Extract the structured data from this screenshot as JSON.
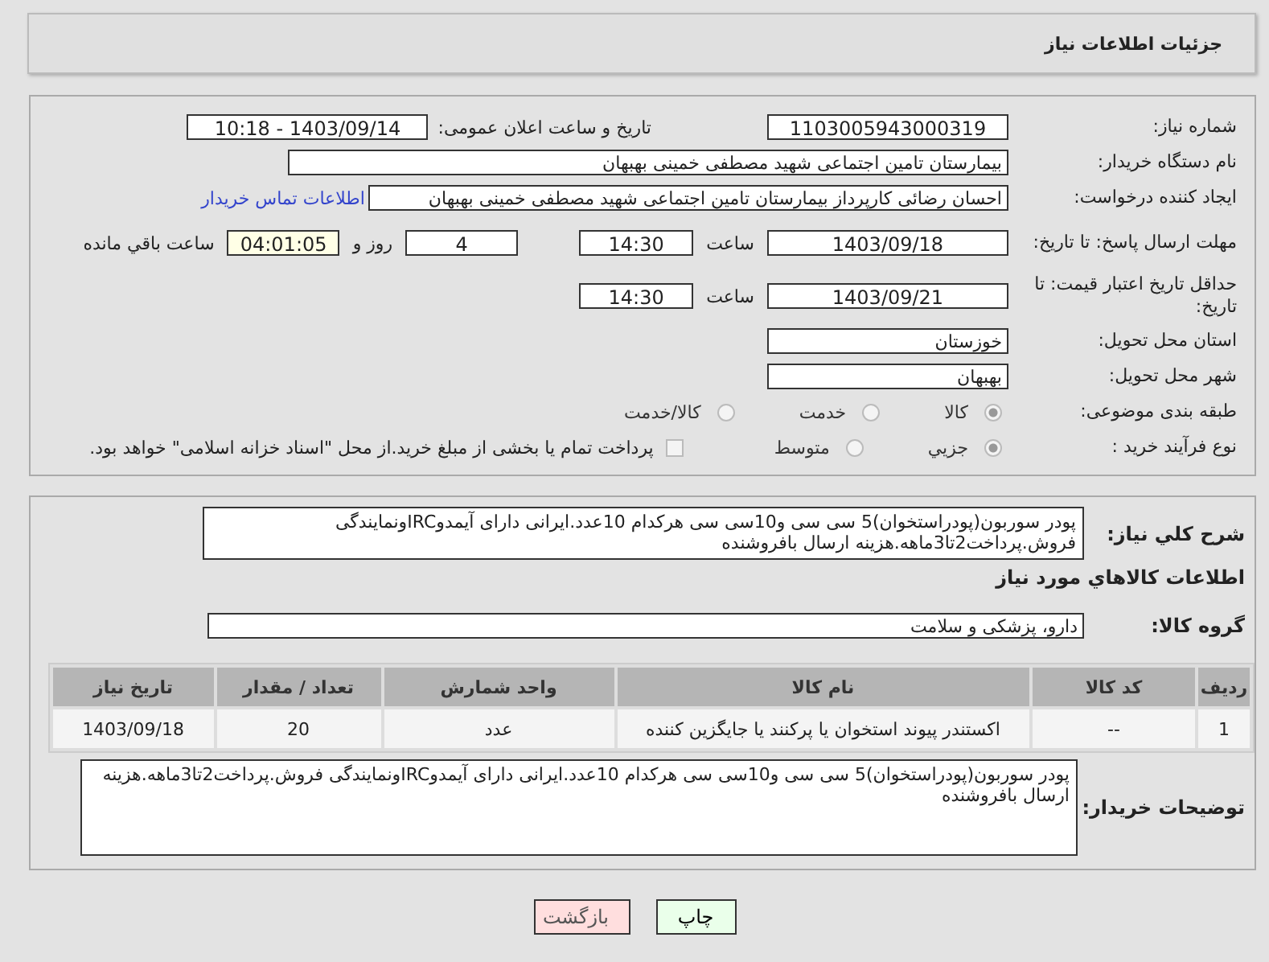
{
  "header": {
    "title": "جزئیات اطلاعات نیاز"
  },
  "details": {
    "need_number": {
      "label": "شماره نیاز:",
      "value": "1103005943000319"
    },
    "announce": {
      "label": "تاریخ و ساعت اعلان عمومی:",
      "value": "1403/09/14 - 10:18"
    },
    "buyer": {
      "label": "نام دستگاه خریدار:",
      "value": "بیمارستان تامین اجتماعی شهید مصطفی خمینی بهبهان"
    },
    "creator": {
      "label": "ایجاد کننده درخواست:",
      "value": "احسان رضائی کارپرداز بیمارستان تامین اجتماعی شهید مصطفی خمینی بهبهان",
      "link": "اطلاعات تماس خریدار"
    },
    "deadline": {
      "label": "مهلت ارسال پاسخ: تا تاریخ:",
      "date": "1403/09/18",
      "time_label": "ساعت",
      "time": "14:30",
      "days": "4",
      "days_label": "روز و",
      "remaining": "04:01:05",
      "remaining_label": "ساعت باقي مانده"
    },
    "validity": {
      "label": "حداقل تاریخ اعتبار قیمت: تا تاریخ:",
      "date": "1403/09/21",
      "time_label": "ساعت",
      "time": "14:30"
    },
    "province": {
      "label": "استان محل تحویل:",
      "value": "خوزستان"
    },
    "city": {
      "label": "شهر محل تحویل:",
      "value": "بهبهان"
    },
    "category": {
      "label": "طبقه بندی موضوعی:",
      "options": [
        {
          "label": "کالا",
          "selected": true
        },
        {
          "label": "خدمت",
          "selected": false
        },
        {
          "label": "کالا/خدمت",
          "selected": false
        }
      ]
    },
    "process": {
      "label": "نوع فرآیند خرید :",
      "options": [
        {
          "label": "جزیي",
          "selected": true
        },
        {
          "label": "متوسط",
          "selected": false
        }
      ],
      "payment": {
        "label": "پرداخت تمام یا بخشی از مبلغ خرید.از محل \"اسناد خزانه اسلامی\" خواهد بود.",
        "checked": false
      }
    }
  },
  "goods": {
    "description": {
      "label": "شرح کلي نیاز:",
      "value": "پودر سوربون(پودراستخوان)5 سی سی و10سی سی هرکدام 10عدد.ایرانی دارای آیمدوIRCونمایندگی فروش.پرداخت2تا3ماهه.هزینه ارسال بافروشنده"
    },
    "section_title": "اطلاعات كالاهاي مورد نیاز",
    "group": {
      "label": "گروه کالا:",
      "value": "دارو، پزشکی و سلامت"
    },
    "table": {
      "columns": [
        "ردیف",
        "کد کالا",
        "نام کالا",
        "واحد شمارش",
        "تعداد / مقدار",
        "تاریخ نیاز"
      ],
      "rows": [
        [
          "1",
          "--",
          "اکستندر پیوند استخوان یا پرکنند یا جایگزین کننده",
          "عدد",
          "20",
          "1403/09/18"
        ]
      ]
    },
    "buyer_notes": {
      "label": "توضیحات خریدار:",
      "value": "پودر سوربون(پودراستخوان)5 سی سی و10سی سی هرکدام 10عدد.ایرانی دارای آیمدوIRCونمایندگی فروش.پرداخت2تا3ماهه.هزینه ارسال بافروشنده"
    }
  },
  "buttons": [
    {
      "label": "چاپ",
      "kind": "print"
    },
    {
      "label": "بازگشت",
      "kind": "back"
    }
  ]
}
